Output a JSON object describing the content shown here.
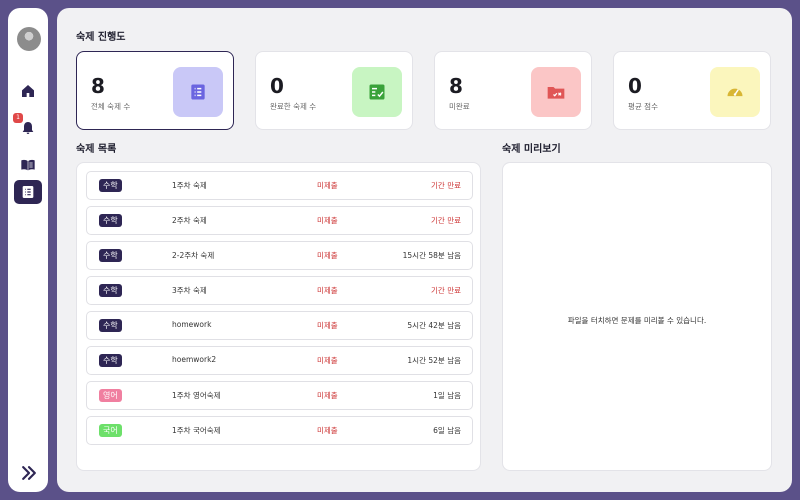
{
  "progress": {
    "title": "숙제 진행도",
    "cards": [
      {
        "value": "8",
        "label": "전체 숙제 수",
        "icon": "list-icon",
        "color": "#c9c8f7"
      },
      {
        "value": "0",
        "label": "완료한 숙제 수",
        "icon": "checklist-icon",
        "color": "#c8f5c2"
      },
      {
        "value": "8",
        "label": "미완료",
        "icon": "folder-x-icon",
        "color": "#fbc6c6"
      },
      {
        "value": "0",
        "label": "평균 점수",
        "icon": "gauge-icon",
        "color": "#fbf6bd"
      }
    ]
  },
  "homework_list": {
    "title": "숙제 목록",
    "rows": [
      {
        "subject": "수학",
        "subject_color": "#2e2654",
        "name": "1주차 숙제",
        "status": "미제출",
        "time": "기간 만료",
        "expired": true
      },
      {
        "subject": "수학",
        "subject_color": "#2e2654",
        "name": "2주차 숙제",
        "status": "미제출",
        "time": "기간 만료",
        "expired": true
      },
      {
        "subject": "수학",
        "subject_color": "#2e2654",
        "name": "2-2주차 숙제",
        "status": "미제출",
        "time": "15시간 58분 남음",
        "expired": false
      },
      {
        "subject": "수학",
        "subject_color": "#2e2654",
        "name": "3주차 숙제",
        "status": "미제출",
        "time": "기간 만료",
        "expired": true
      },
      {
        "subject": "수학",
        "subject_color": "#2e2654",
        "name": "homework",
        "status": "미제출",
        "time": "5시간 42분 남음",
        "expired": false
      },
      {
        "subject": "수학",
        "subject_color": "#2e2654",
        "name": "hoemwork2",
        "status": "미제출",
        "time": "1시간 52분 남음",
        "expired": false
      },
      {
        "subject": "영어",
        "subject_color": "#f07fa0",
        "name": "1주차 영어숙제",
        "status": "미제출",
        "time": "1일 남음",
        "expired": false
      },
      {
        "subject": "국어",
        "subject_color": "#6de06a",
        "name": "1주차 국어숙제",
        "status": "미제출",
        "time": "6일 남음",
        "expired": false
      }
    ]
  },
  "preview": {
    "title": "숙제 미리보기",
    "message": "파일을 터치하면 문제를 미리볼 수 있습니다."
  },
  "sidebar": {
    "notification_badge": "1",
    "items": [
      {
        "icon": "home-icon"
      },
      {
        "icon": "bell-icon"
      },
      {
        "icon": "book-icon"
      },
      {
        "icon": "list-icon"
      }
    ],
    "active_color": "#2e2654"
  }
}
